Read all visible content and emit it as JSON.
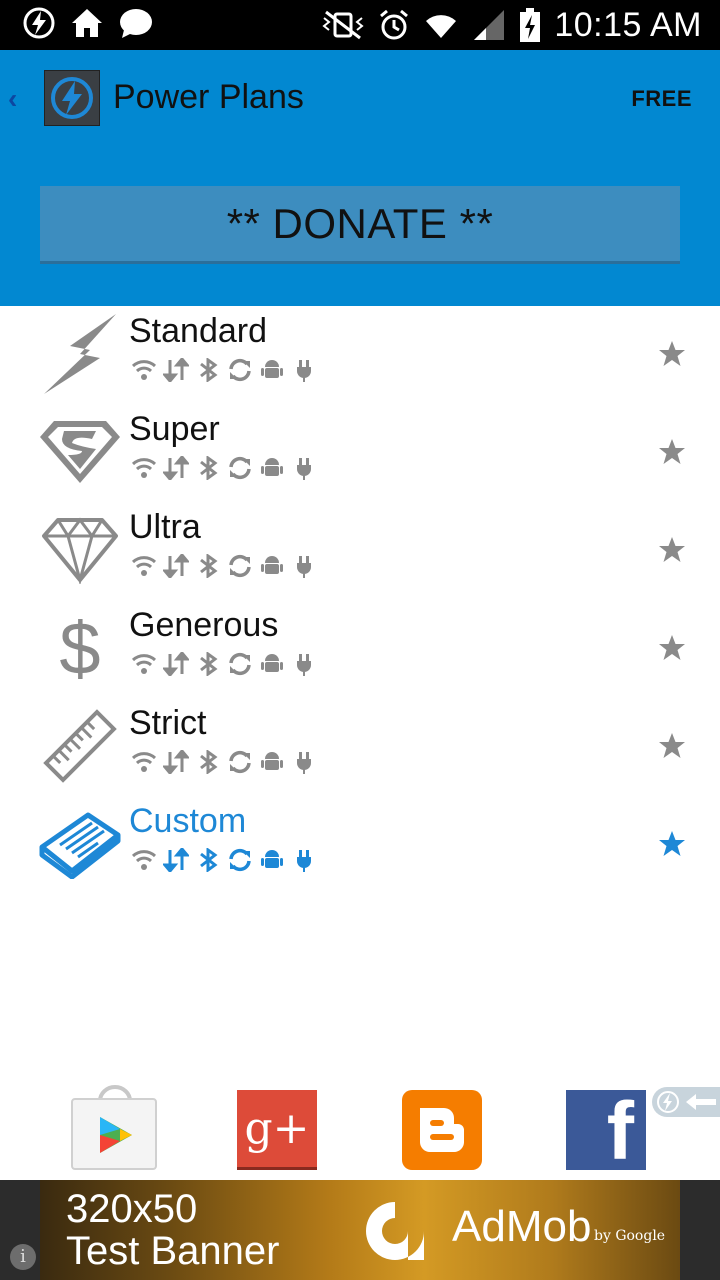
{
  "status_bar": {
    "time": "10:15 AM",
    "left_icons": [
      "power-saver-icon",
      "home-icon",
      "chat-bubble-icon"
    ],
    "right_icons": [
      "vibrate-mute-icon",
      "alarm-icon",
      "wifi-icon",
      "signal-icon",
      "battery-charging-icon"
    ]
  },
  "header": {
    "title": "Power Plans",
    "badge": "FREE",
    "donate_label": "** DONATE **",
    "accent_color": "#0288d1"
  },
  "plans": [
    {
      "name": "Standard",
      "icon": "lightning-icon",
      "active": false
    },
    {
      "name": "Super",
      "icon": "superman-shield-icon",
      "active": false
    },
    {
      "name": "Ultra",
      "icon": "diamond-icon",
      "active": false
    },
    {
      "name": "Generous",
      "icon": "dollar-icon",
      "active": false
    },
    {
      "name": "Strict",
      "icon": "ruler-icon",
      "active": false
    },
    {
      "name": "Custom",
      "icon": "notepad-icon",
      "active": true
    }
  ],
  "plan_toggle_icons": [
    "wifi-icon",
    "data-sync-arrows-icon",
    "bluetooth-icon",
    "auto-sync-icon",
    "android-icon",
    "power-plug-icon"
  ],
  "colors": {
    "inactive_gray": "#8a8a8a",
    "active_blue": "#1e88d6"
  },
  "social": [
    "google-play-icon",
    "google-plus-icon",
    "blogger-icon",
    "facebook-icon"
  ],
  "ad": {
    "line1": "320x50",
    "line2": "Test Banner",
    "brand": "AdMob",
    "by": "by Google"
  }
}
